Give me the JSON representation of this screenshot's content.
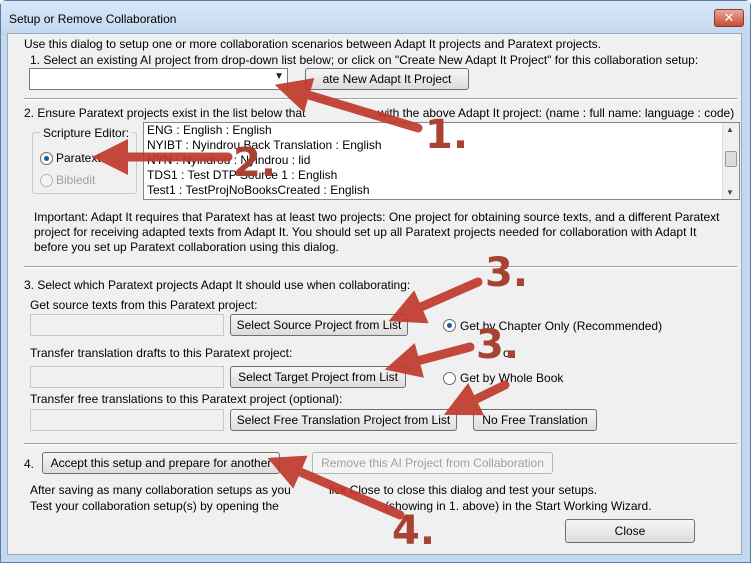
{
  "window": {
    "title": "Setup or Remove Collaboration",
    "close_glyph": "✕"
  },
  "intro": "Use this dialog to setup one or more collaboration scenarios between Adapt It projects and Paratext projects.",
  "step1": {
    "label": "1. Select an existing AI project from drop-down list below; or click on \"Create New Adapt It Project\" for this collaboration setup:",
    "combo_value": "",
    "create_button": "ate New Adapt It Project"
  },
  "step2": {
    "label_left": "2. Ensure Paratext projects exist in the list below that",
    "label_right": "with the above Adapt It project: (name : full name: language : code)",
    "editor_group_label": "Scripture Editor:",
    "editor_options": [
      "Paratext",
      "Bibledit"
    ],
    "projects": [
      "ENG : English : English",
      "NYIBT : Nyindrou Back Translation : English",
      "NYN : Nyindrou : Nyindrou : lid",
      "TDS1 : Test DTP Source 1 : English",
      "Test1 : TestProjNoBooksCreated : English"
    ],
    "important_note": "Important: Adapt It requires that Paratext has at least two projects: One project for obtaining source texts, and a different Paratext project for receiving adapted texts from Adapt It. You should set up all Paratext projects needed for collaboration with Adapt It before you set up Paratext collaboration using this dialog."
  },
  "step3": {
    "label": "3. Select which Paratext projects Adapt It should use when collaborating:",
    "source_label": "Get source texts from this Paratext project:",
    "source_button": "Select Source Project from List",
    "target_label": "Transfer translation drafts to this Paratext project:",
    "target_button": "Select Target Project from List",
    "free_label": "Transfer free translations to this Paratext project (optional):",
    "free_button": "Select Free Translation Project from List",
    "no_free_button": "No Free Translation",
    "chapter_option": "Get by Chapter Only (Recommended)",
    "or_text": "or",
    "book_option": "Get by Whole Book"
  },
  "step4": {
    "number": "4.",
    "accept_button": "Accept this setup and prepare for another",
    "remove_button": "Remove this AI Project from Collaboration",
    "after_line1_left": "After saving as many collaboration setups as you",
    "after_line1_right": "lick Close to close this dialog and test your setups.",
    "after_line2_left": "Test your collaboration setup(s) by opening the",
    "after_line2_right": "(showing in 1. above) in the Start Working Wizard.",
    "close_button": "Close"
  },
  "annotations": [
    "1.",
    "2.",
    "3.",
    "3.",
    "4."
  ],
  "colors": {
    "annotation_arrow": "#c0392b",
    "annotation_text": "#a84232"
  }
}
